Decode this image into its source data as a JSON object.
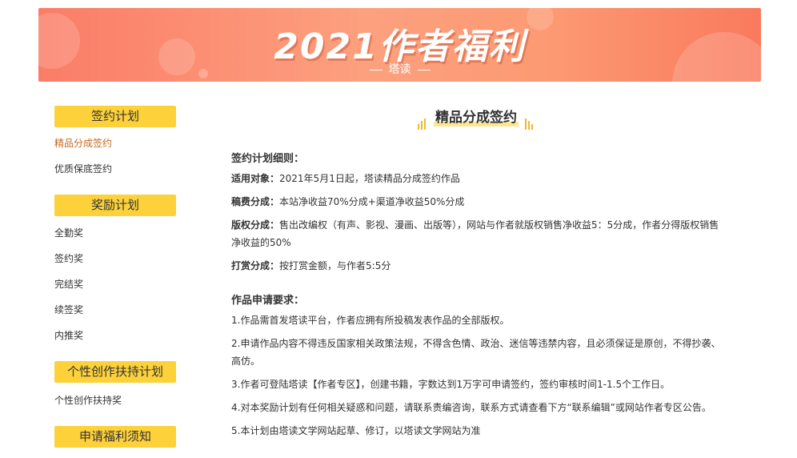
{
  "banner": {
    "title": "2021作者福利",
    "subtitle": "塔读"
  },
  "sidebar": {
    "groups": [
      {
        "title": "签约计划",
        "items": [
          "精品分成签约",
          "优质保底签约"
        ]
      },
      {
        "title": "奖励计划",
        "items": [
          "全勤奖",
          "签约奖",
          "完结奖",
          "续签奖",
          "内推奖"
        ]
      },
      {
        "title": "个性创作扶持计划",
        "items": [
          "个性创作扶持奖"
        ]
      },
      {
        "title": "申请福利须知",
        "items": []
      }
    ],
    "active_item": "精品分成签约"
  },
  "main": {
    "title": "精品分成签约",
    "rules": {
      "heading": "签约计划细则：",
      "items": [
        {
          "label": "适用对象：",
          "text": "2021年5月1日起，塔读精品分成签约作品"
        },
        {
          "label": "稿费分成：",
          "text": "本站净收益70%分成+渠道净收益50%分成"
        },
        {
          "label": "版权分成：",
          "text": "售出改编权（有声、影视、漫画、出版等），网站与作者就版权销售净收益5：5分成，作者分得版权销售净收益的50%"
        },
        {
          "label": "打赏分成：",
          "text": "按打赏金额，与作者5:5分"
        }
      ]
    },
    "requirements": {
      "heading": "作品申请要求：",
      "items": [
        "1.作品需首发塔读平台，作者应拥有所投稿发表作品的全部版权。",
        "2.申请作品内容不得违反国家相关政策法规，不得含色情、政治、迷信等违禁内容，且必须保证是原创，不得抄袭、高仿。",
        "3.作者可登陆塔读【作者专区】，创建书籍，字数达到1万字可申请签约，签约审核时间1-1.5个工作日。",
        "4.对本奖励计划有任何相关疑惑和问题，请联系责编咨询，联系方式请查看下方“联系编辑”或网站作者专区公告。",
        "5.本计划由塔读文学网站起草、修订，以塔读文学网站为准"
      ]
    }
  },
  "colors": {
    "banner_start": "#fb7d67",
    "banner_end": "#f97a5e",
    "side_head_bg": "#fdd13a",
    "active_link": "#c46a22",
    "bars": "#f1b82a"
  }
}
